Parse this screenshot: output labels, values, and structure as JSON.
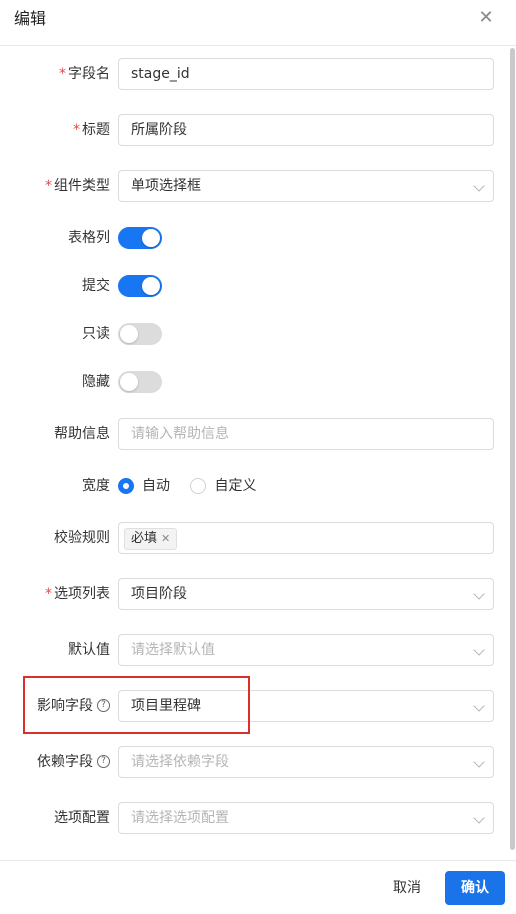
{
  "dialog": {
    "title": "编辑",
    "close_icon": "close-icon"
  },
  "fields": {
    "field_name": {
      "label": "字段名",
      "required": true,
      "value": "stage_id"
    },
    "title": {
      "label": "标题",
      "required": true,
      "value": "所属阶段"
    },
    "component_type": {
      "label": "组件类型",
      "required": true,
      "value": "单项选择框"
    },
    "table_column": {
      "label": "表格列",
      "on": true
    },
    "submit": {
      "label": "提交",
      "on": true
    },
    "readonly": {
      "label": "只读",
      "on": false
    },
    "hidden": {
      "label": "隐藏",
      "on": false
    },
    "help_info": {
      "label": "帮助信息",
      "placeholder": "请输入帮助信息"
    },
    "width": {
      "label": "宽度",
      "options": [
        "自动",
        "自定义"
      ],
      "selected": "自动"
    },
    "validation": {
      "label": "校验规则",
      "tags": [
        "必填"
      ]
    },
    "option_list": {
      "label": "选项列表",
      "required": true,
      "value": "项目阶段"
    },
    "default_value": {
      "label": "默认值",
      "placeholder": "请选择默认值"
    },
    "affected_field": {
      "label": "影响字段",
      "value": "项目里程碑",
      "help_icon": "question-circle-icon"
    },
    "depends_field": {
      "label": "依赖字段",
      "placeholder": "请选择依赖字段",
      "help_icon": "question-circle-icon"
    },
    "option_config": {
      "label": "选项配置",
      "placeholder": "请选择选项配置"
    }
  },
  "footer": {
    "cancel_label": "取消",
    "confirm_label": "确认"
  },
  "colors": {
    "accent": "#1976f2",
    "required": "#e5484d",
    "highlight": "#d9302c"
  }
}
